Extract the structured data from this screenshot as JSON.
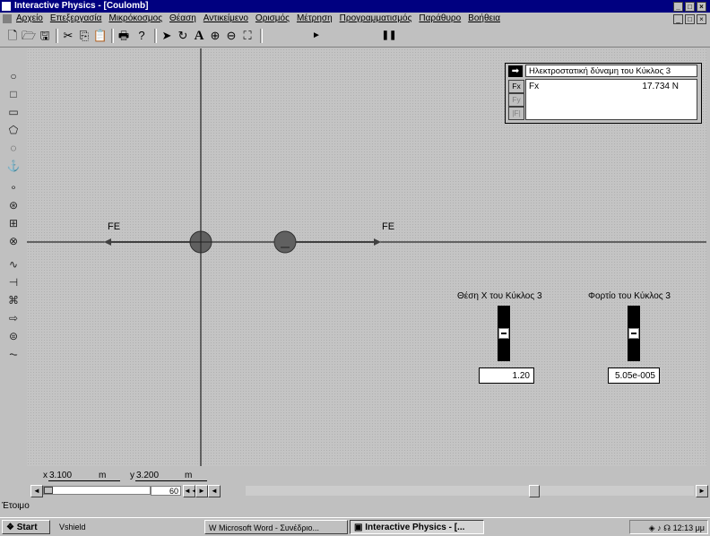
{
  "window": {
    "title": "Interactive Physics - [Coulomb]"
  },
  "menu": {
    "items": [
      "Αρχείο",
      "Επεξεργασία",
      "Μικρόκοσμος",
      "Θέαση",
      "Αντικείμενο",
      "Ορισμός",
      "Μέτρηση",
      "Προγραμματισμός",
      "Παράθυρο",
      "Βοήθεια"
    ]
  },
  "toolbar": {
    "icons": [
      "new-icon",
      "open-icon",
      "save-icon",
      "cut-icon",
      "copy-icon",
      "paste-icon",
      "print-icon",
      "help-icon",
      "select-arrow-icon",
      "rotate-icon",
      "text-tool-icon",
      "zoom-in-icon",
      "zoom-out-icon",
      "fit-view-icon",
      "run-icon",
      "pause-icon"
    ],
    "text_tool_glyph": "A"
  },
  "palette": {
    "icons": [
      "circle-icon",
      "square-icon",
      "rectangle-icon",
      "polygon-icon",
      "curved-body-icon",
      "anchor-icon",
      "point-icon",
      "pin-joint-icon",
      "slot-joint-icon",
      "rigid-joint-icon",
      "spring-icon",
      "damper-icon",
      "rope-icon",
      "force-icon",
      "torque-icon",
      "actuator-icon"
    ]
  },
  "simulation": {
    "force_label_left": "FE",
    "force_label_right": "FE"
  },
  "meter": {
    "title": "Ηλεκτροστατική δύναμη του Κύκλος 3",
    "tabs": [
      "Fx",
      "Fy",
      "|F|"
    ],
    "label": "Fx",
    "value": "17.734 N"
  },
  "sliders": [
    {
      "label": "Θέση X του Κύκλος 3",
      "value": "1.20",
      "level": 0.5
    },
    {
      "label": "Φορτίο του Κύκλος 3",
      "value": "5.05e-005",
      "level": 0.5
    }
  ],
  "coordinates": {
    "x_label": "x",
    "x_value": "3.100",
    "x_unit": "m",
    "y_label": "y",
    "y_value": "3.200",
    "y_unit": "m"
  },
  "frames": {
    "value": "60"
  },
  "status": {
    "text": "Έτοιμο"
  },
  "taskbar": {
    "start": "Start",
    "tasks": [
      "Vshield",
      "Microsoft Word - Συνέδριο...",
      "Interactive Physics - [..."
    ],
    "clock": "12:13 μμ"
  },
  "colors": {
    "titlebar": "#000080",
    "charge": "#606060",
    "canvas": "#c4c4c4"
  }
}
